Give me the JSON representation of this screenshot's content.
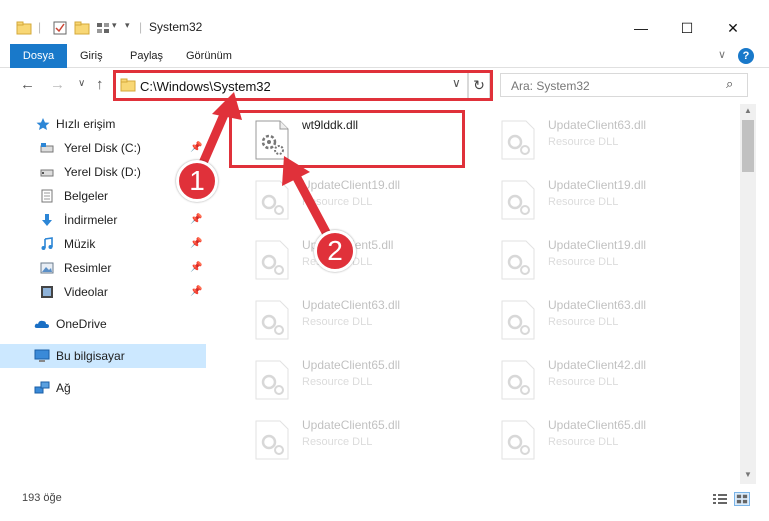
{
  "window": {
    "title": "System32",
    "controls": {
      "minimize": "—",
      "maximize": "☐",
      "close": "✕"
    }
  },
  "ribbon": {
    "tabs": [
      {
        "label": "Dosya",
        "active": true
      },
      {
        "label": "Giriş",
        "active": false
      },
      {
        "label": "Paylaş",
        "active": false
      },
      {
        "label": "Görünüm",
        "active": false
      }
    ],
    "expand": "∨",
    "help": "?"
  },
  "nav": {
    "back": "←",
    "forward": "→",
    "recent": "∨",
    "up": "↑",
    "address": "C:\\Windows\\System32",
    "address_dropdown": "∨",
    "refresh": "↻",
    "search_placeholder": "Ara: System32",
    "search_icon": "⌕"
  },
  "sidebar": {
    "items": [
      {
        "label": "Hızlı erişim",
        "icon": "star-icon",
        "pinned": false
      },
      {
        "label": "Yerel Disk (C:)",
        "icon": "drive-icon",
        "pinned": true
      },
      {
        "label": "Yerel Disk (D:)",
        "icon": "drive-icon",
        "pinned": false
      },
      {
        "label": "Belgeler",
        "icon": "documents-icon",
        "pinned": true
      },
      {
        "label": "İndirmeler",
        "icon": "downloads-icon",
        "pinned": true
      },
      {
        "label": "Müzik",
        "icon": "music-icon",
        "pinned": true
      },
      {
        "label": "Resimler",
        "icon": "pictures-icon",
        "pinned": true
      },
      {
        "label": "Videolar",
        "icon": "videos-icon",
        "pinned": true
      },
      {
        "label": "OneDrive",
        "icon": "cloud-icon",
        "pinned": false
      },
      {
        "label": "Bu bilgisayar",
        "icon": "computer-icon",
        "pinned": false,
        "selected": true
      },
      {
        "label": "Ağ",
        "icon": "network-icon",
        "pinned": false
      }
    ],
    "pin_glyph": "📌"
  },
  "files": [
    {
      "name": "wt9lddk.dll",
      "type": "",
      "highlight": true
    },
    {
      "name": "UpdateClient63.dll",
      "type": "Resource DLL"
    },
    {
      "name": "UpdateClient19.dll",
      "type": "Resource DLL"
    },
    {
      "name": "UpdateClient19.dll",
      "type": "Resource DLL"
    },
    {
      "name": "UpdateClient5.dll",
      "type": "Resource DLL"
    },
    {
      "name": "UpdateClient19.dll",
      "type": "Resource DLL"
    },
    {
      "name": "UpdateClient63.dll",
      "type": "Resource DLL"
    },
    {
      "name": "UpdateClient63.dll",
      "type": "Resource DLL"
    },
    {
      "name": "UpdateClient65.dll",
      "type": "Resource DLL"
    },
    {
      "name": "UpdateClient42.dll",
      "type": "Resource DLL"
    },
    {
      "name": "UpdateClient65.dll",
      "type": "Resource DLL"
    },
    {
      "name": "UpdateClient65.dll",
      "type": "Resource DLL"
    }
  ],
  "status": {
    "count": "193 öğe"
  },
  "callouts": [
    "1",
    "2"
  ],
  "colors": {
    "accent": "#1979ca",
    "highlight": "#e0313a",
    "selected": "#cce8ff"
  }
}
